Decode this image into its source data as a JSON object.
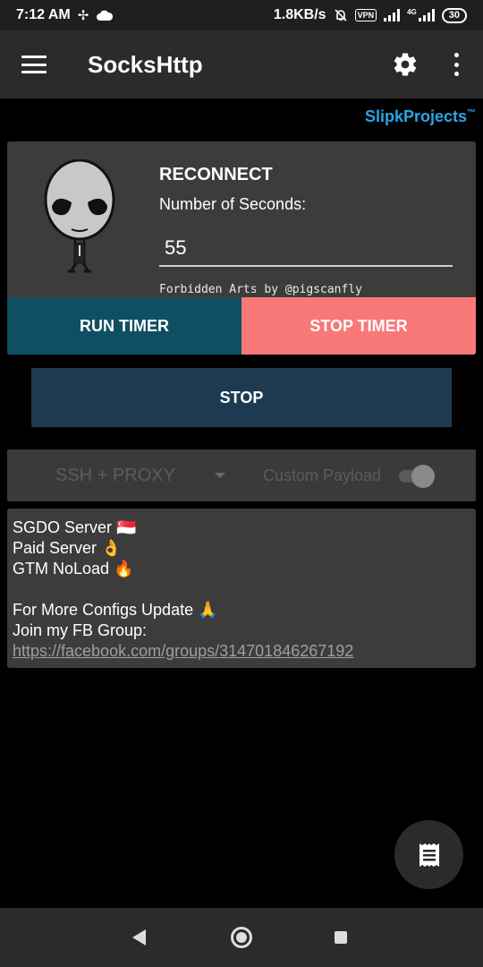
{
  "status_bar": {
    "time": "7:12 AM",
    "speed": "1.8KB/s",
    "vpn": "VPN",
    "network": "4G",
    "battery": "30"
  },
  "toolbar": {
    "title": "SocksHttp",
    "menu_icon": "hamburger-icon",
    "settings_icon": "gear-icon",
    "more_icon": "more-vert-icon"
  },
  "brand": {
    "name": "SlipkProjects",
    "mark": "™",
    "color": "#2aa5e6"
  },
  "reconnect": {
    "title": "RECONNECT",
    "seconds_label": "Number of Seconds:",
    "seconds_value": "55",
    "credit": "Forbidden Arts by @pigscanfly",
    "run_timer": "RUN TIMER",
    "stop_timer": "STOP TIMER"
  },
  "main": {
    "stop": "STOP"
  },
  "mode": {
    "selected": "SSH + PROXY",
    "payload_label": "Custom Payload",
    "payload_enabled": false
  },
  "notes": {
    "lines": [
      "SGDO Server 🇸🇬",
      "Paid Server 👌",
      "GTM NoLoad 🔥",
      "For More Configs Update 🙏",
      "Join my FB Group:"
    ],
    "link": "https://facebook.com/groups/314701846267192"
  },
  "fab": {
    "icon": "receipt-log-icon"
  },
  "colors": {
    "run_timer": "#0f4f63",
    "stop_timer": "#f87878",
    "stop": "#1d3a50",
    "card": "#3c3c3c"
  }
}
